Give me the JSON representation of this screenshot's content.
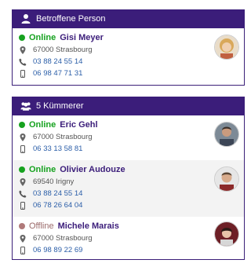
{
  "affected": {
    "header": "Betroffene Person",
    "person": {
      "status": "Online",
      "name": "Gisi Meyer",
      "address": "67000 Strasbourg",
      "phone": "03 88 24 55 14",
      "mobile": "06 98 47 71 31"
    }
  },
  "caretakers": {
    "header": "5 Kümmerer",
    "people": [
      {
        "status": "Online",
        "name": "Eric Gehl",
        "address": "67000 Strasbourg",
        "mobile": "06 33 13 58 81"
      },
      {
        "status": "Online",
        "name": "Olivier Audouze",
        "address": "69540 Irigny",
        "phone": "03 88 24 55 14",
        "mobile": "06 78 26 64 04"
      },
      {
        "status": "Offline",
        "name": "Michele Marais",
        "address": "67000 Strasbourg",
        "mobile": "06 98 89 22 69"
      }
    ]
  },
  "colors": {
    "header": "#3b1d7a",
    "online": "#16a21f",
    "offline": "#b07a7a",
    "link": "#2b5ea8"
  }
}
